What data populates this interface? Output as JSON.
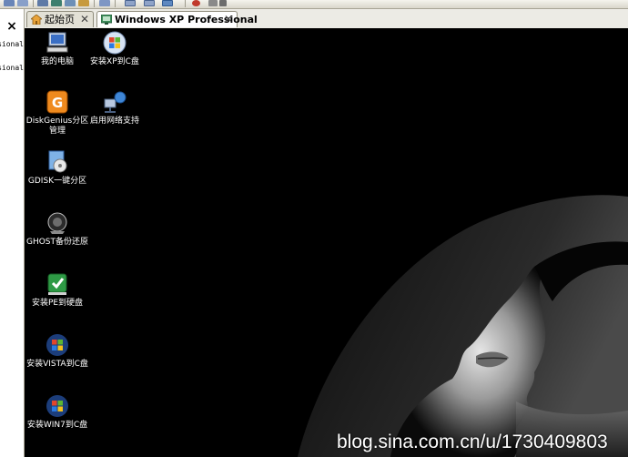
{
  "left_panel": {
    "close_glyph": "×",
    "lines": [
      "Windows XP Professional",
      "Windows XP Professional"
    ]
  },
  "tabs": [
    {
      "label": "起始页",
      "close_glyph": "✕",
      "state": "inactive"
    },
    {
      "label": "Windows XP Professional",
      "close_glyph": "✕",
      "state": "active"
    }
  ],
  "desktop_icons": [
    {
      "label": "我的电脑",
      "icon": "my-computer-icon"
    },
    {
      "label": "安装XP到C盘",
      "icon": "windows-setup-icon"
    },
    {
      "label": "DiskGenius分区管理",
      "icon": "diskgenius-icon"
    },
    {
      "label": "启用网络支持",
      "icon": "network-icon"
    },
    {
      "label": "GDISK一键分区",
      "icon": "gdisk-icon"
    },
    {
      "label": "GHOST备份还原",
      "icon": "ghost-icon"
    },
    {
      "label": "安装PE到硬盘",
      "icon": "pe-install-icon"
    },
    {
      "label": "安装VISTA到C盘",
      "icon": "vista-setup-icon"
    },
    {
      "label": "安装WIN7到C盘",
      "icon": "win7-setup-icon"
    }
  ],
  "watermark": "blog.sina.com.cn/u/1730409803",
  "colors": {
    "desktop_bg": "#000000",
    "tab_active": "#ffffff",
    "tab_inactive": "#e3e1d6"
  }
}
